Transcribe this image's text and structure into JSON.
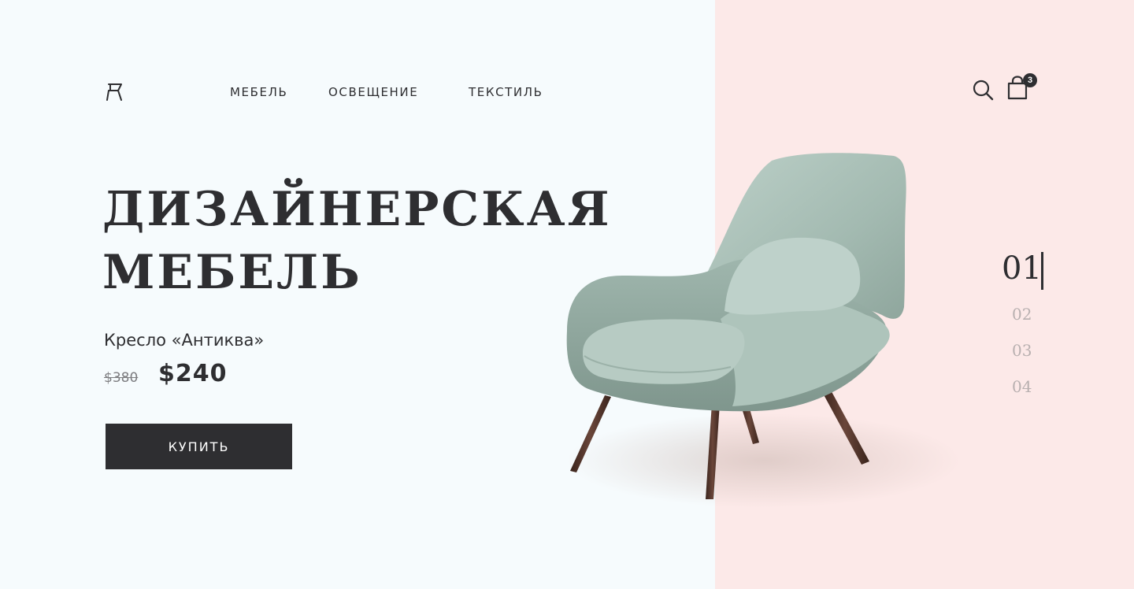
{
  "header": {
    "logo_icon": "chair-logo-icon",
    "nav": [
      {
        "label": "МЕБЕЛЬ"
      },
      {
        "label": "ОСВЕЩЕНИЕ"
      },
      {
        "label": "ТЕКСТИЛЬ"
      }
    ],
    "search_icon": "search-icon",
    "cart_icon": "shopping-bag-icon",
    "cart_count": "3"
  },
  "hero": {
    "headline_line1": "ДИЗАЙНЕРСКАЯ",
    "headline_line2": "МЕБЕЛЬ",
    "product_name": "Кресло «Антиква»",
    "old_price": "$380",
    "new_price": "$240",
    "buy_label": "КУПИТЬ"
  },
  "slider": {
    "active": "01",
    "items": [
      "02",
      "03",
      "04"
    ]
  },
  "colors": {
    "background": "#f6fbfd",
    "accent_panel": "#fce9e8",
    "dark": "#2e2e31",
    "chair_fabric": "#a8bfb6",
    "chair_legs": "#4a3026"
  }
}
